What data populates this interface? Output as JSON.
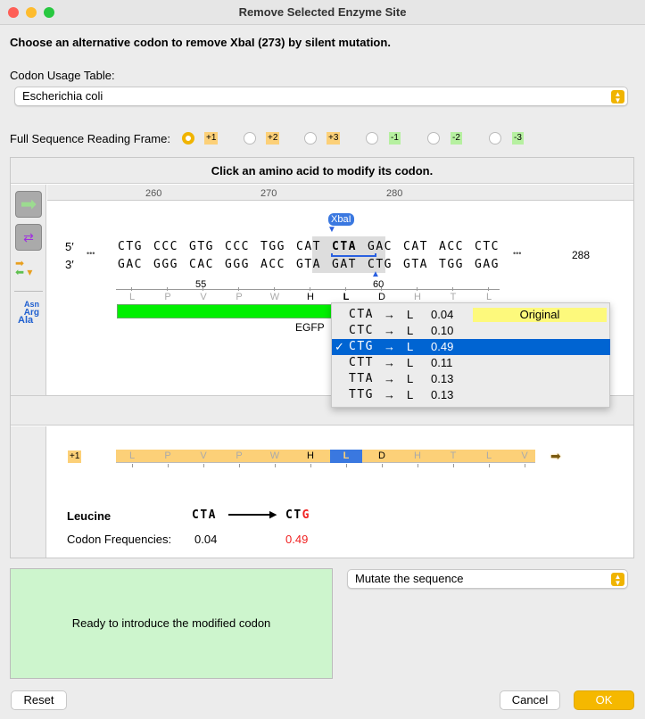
{
  "window": {
    "title": "Remove Selected Enzyme Site"
  },
  "heading": "Choose an alternative codon to remove XbaI (273) by silent mutation.",
  "codon_table": {
    "label": "Codon Usage Table:",
    "value": "Escherichia coli"
  },
  "reading_frame": {
    "label": "Full Sequence Reading Frame:",
    "options": [
      "+1",
      "+2",
      "+3",
      "-1",
      "-2",
      "-3"
    ],
    "selected": "+1"
  },
  "panel": {
    "instruction": "Click an amino acid to modify its codon.",
    "ruler": [
      "260",
      "270",
      "280"
    ],
    "strand5": "5′",
    "strand3": "3′",
    "ellipsis": "•••",
    "top_codons": [
      "CTG",
      "CCC",
      "GTG",
      "CCC",
      "TGG",
      "CAT",
      "CTA",
      "GAC",
      "CAT",
      "ACC",
      "CTC"
    ],
    "bottom_codons": [
      "GAC",
      "GGG",
      "CAC",
      "GGG",
      "ACC",
      "GTA",
      "GAT",
      "CTG",
      "GTA",
      "TGG",
      "GAG"
    ],
    "end_number": "288",
    "enzyme": "XbaI",
    "aa_numbers": [
      "55",
      "60"
    ],
    "amino_acids": [
      "L",
      "P",
      "V",
      "P",
      "W",
      "H",
      "L",
      "D",
      "H",
      "T",
      "L"
    ],
    "feature": "EGFP",
    "tool_labels": [
      "Asn",
      "Arg",
      "Ala"
    ]
  },
  "codon_menu": [
    {
      "codon": "CTA",
      "aa": "L",
      "freq": "0.04",
      "tag": "Original",
      "checked": false
    },
    {
      "codon": "CTC",
      "aa": "L",
      "freq": "0.10",
      "checked": false
    },
    {
      "codon": "CTG",
      "aa": "L",
      "freq": "0.49",
      "checked": true
    },
    {
      "codon": "CTT",
      "aa": "L",
      "freq": "0.11",
      "checked": false
    },
    {
      "codon": "TTA",
      "aa": "L",
      "freq": "0.13",
      "checked": false
    },
    {
      "codon": "TTG",
      "aa": "L",
      "freq": "0.13",
      "checked": false
    }
  ],
  "arrow": "→",
  "check": "✓",
  "translation": {
    "frame": "+1",
    "amino_acids": [
      "L",
      "P",
      "V",
      "P",
      "W",
      "H",
      "L",
      "D",
      "H",
      "T",
      "L",
      "V"
    ]
  },
  "summary": {
    "amino_acid": "Leucine",
    "from": "CTA",
    "to_prefix": "CT",
    "to_changed": "G",
    "freq_label": "Codon Frequencies:",
    "from_freq": "0.04",
    "to_freq": "0.49"
  },
  "status": "Ready to introduce the modified codon",
  "action": {
    "value": "Mutate the sequence"
  },
  "buttons": {
    "reset": "Reset",
    "cancel": "Cancel",
    "ok": "OK"
  }
}
